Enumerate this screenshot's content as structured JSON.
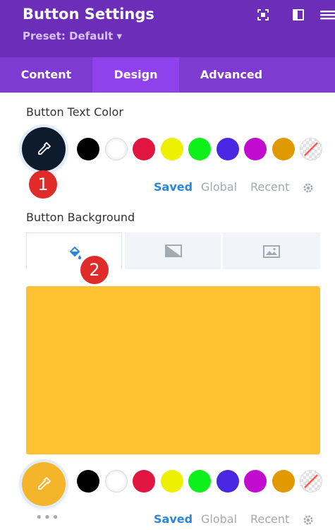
{
  "header": {
    "title": "Button Settings",
    "preset_label": "Preset: Default ▾",
    "background": "#6c2eb9"
  },
  "tabs": [
    {
      "label": "Content",
      "active": false
    },
    {
      "label": "Design",
      "active": true
    },
    {
      "label": "Advanced",
      "active": false
    }
  ],
  "text_color": {
    "label": "Button Text Color",
    "selected_color": "#0e1b2d",
    "badge": "1",
    "swatches": [
      "#000000",
      "#ffffff",
      "#e01540",
      "#edf000",
      "#0df019",
      "#4a27e3",
      "#c10bce",
      "#e09900",
      "transparent"
    ],
    "view_tabs": {
      "saved": "Saved",
      "global": "Global",
      "recent": "Recent"
    }
  },
  "background": {
    "label": "Button Background",
    "badge": "2",
    "type_tabs": [
      "color-fill-icon",
      "gradient-icon",
      "image-icon"
    ],
    "selected_color": "#ffc12f",
    "swatches": [
      "#000000",
      "#ffffff",
      "#e01540",
      "#edf000",
      "#0df019",
      "#4a27e3",
      "#c10bce",
      "#e09900",
      "transparent"
    ],
    "view_tabs": {
      "saved": "Saved",
      "global": "Global",
      "recent": "Recent"
    },
    "more": "•••"
  }
}
